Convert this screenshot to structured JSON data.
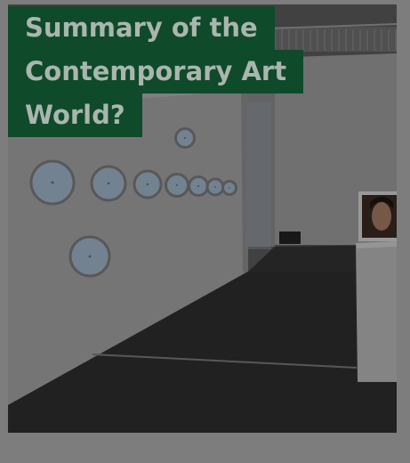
{
  "card": {
    "title_lines": [
      "Summary of the",
      "Contemporary Art",
      "World?"
    ]
  },
  "image": {
    "subject": "gallery-photo",
    "overlay_color": "#0f4a2a",
    "background_color": "#7d7d7d"
  }
}
